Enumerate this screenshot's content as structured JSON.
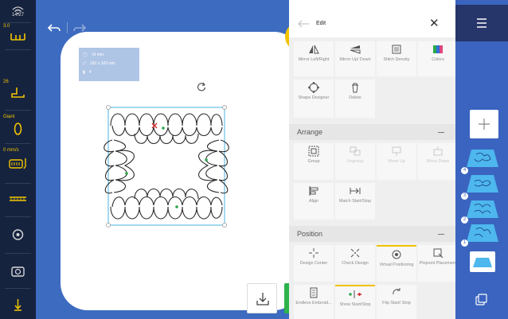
{
  "status_bar": {
    "time": "14:27",
    "needle_value": "3.0",
    "thread_tension": "26",
    "presser_foot": "Giant",
    "speed": "0 mm/s"
  },
  "info_box": {
    "line1": "+5 mm",
    "line2": "182 x 182 mm",
    "line3": "4"
  },
  "panel": {
    "title": "Edit",
    "top_tools": [
      {
        "label": "Mirror Left/Right"
      },
      {
        "label": "Mirror Up/ Down"
      },
      {
        "label": "Stitch Density"
      },
      {
        "label": "Colors"
      }
    ],
    "row2": [
      {
        "label": "Shape Designer"
      },
      {
        "label": "Delete"
      }
    ],
    "arrange": {
      "title": "Arrange",
      "tools": [
        {
          "label": "Group"
        },
        {
          "label": "Ungroup"
        },
        {
          "label": "Move Up"
        },
        {
          "label": "Move Down"
        },
        {
          "label": "Align"
        },
        {
          "label": "Match Start/Stop"
        }
      ]
    },
    "position": {
      "title": "Position",
      "tools": [
        {
          "label": "Design Center"
        },
        {
          "label": "Check Design"
        },
        {
          "label": "Virtual Positioning"
        },
        {
          "label": "Pinpoint Placement"
        },
        {
          "label": "Endless Embroid..."
        },
        {
          "label": "Show Start/Stop"
        },
        {
          "label": "Flip Start/ Stop"
        }
      ]
    }
  },
  "layers": [
    {
      "number": "4"
    },
    {
      "number": "3"
    },
    {
      "number": "2"
    },
    {
      "number": "1"
    }
  ],
  "colors": {
    "accent": "#f2c200",
    "confirm": "#2db34a",
    "canvas": "#3d6bc0",
    "rail": "#3a64bf"
  }
}
